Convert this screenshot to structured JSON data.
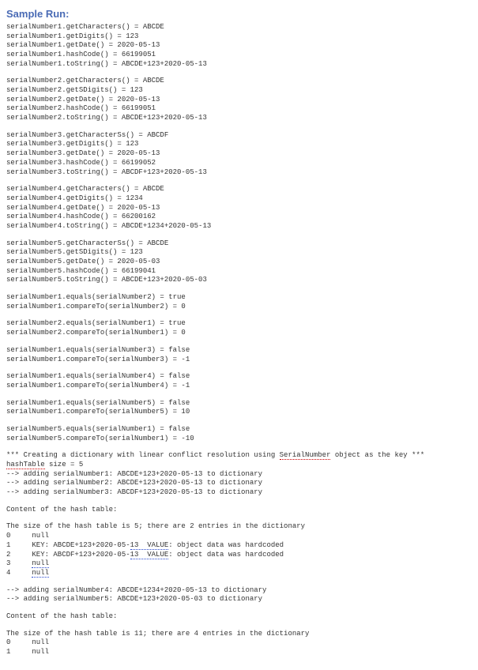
{
  "heading": "Sample Run:",
  "section1": [
    "serialNumber1.getCharacters() = ABCDE",
    "serialNumber1.getDigits() = 123",
    "serialNumber1.getDate() = 2020-05-13",
    "serialNumber1.hashCode() = 66199051",
    "serialNumber1.toString() = ABCDE+123+2020-05-13"
  ],
  "section2": [
    "serialNumber2.getCharacters() = ABCDE",
    "serialNumber2.getSDigits() = 123",
    "serialNumber2.getDate() = 2020-05-13",
    "serialNumber2.hashCode() = 66199051",
    "serialNumber2.toString() = ABCDE+123+2020-05-13"
  ],
  "section3": [
    "serialNumber3.getCharacterSs() = ABCDF",
    "serialNumber3.getDigits() = 123",
    "serialNumber3.getDate() = 2020-05-13",
    "serialNumber3.hashCode() = 66199052",
    "serialNumber3.toString() = ABCDF+123+2020-05-13"
  ],
  "section4": [
    "serialNumber4.getCharacters() = ABCDE",
    "serialNumber4.getDigits() = 1234",
    "serialNumber4.getDate() = 2020-05-13",
    "serialNumber4.hashCode() = 66200162",
    "serialNumber4.toString() = ABCDE+1234+2020-05-13"
  ],
  "section5": [
    "serialNumber5.getCharacterSs() = ABCDE",
    "serialNumber5.getSDigits() = 123",
    "serialNumber5.getDate() = 2020-05-03",
    "serialNumber5.hashCode() = 66199041",
    "serialNumber5.toString() = ABCDE+123+2020-05-03"
  ],
  "cmp1": [
    "serialNumber1.equals(serialNumber2) = true",
    "serialNumber1.compareTo(serialNumber2) = 0"
  ],
  "cmp2": [
    "serialNumber2.equals(serialNumber1) = true",
    "serialNumber2.compareTo(serialNumber1) = 0"
  ],
  "cmp3": [
    "serialNumber1.equals(serialNumber3) = false",
    "serialNumber1.compareTo(serialNumber3) = -1"
  ],
  "cmp4": [
    "serialNumber1.equals(serialNumber4) = false",
    "serialNumber1.compareTo(serialNumber4) = -1"
  ],
  "cmp5": [
    "serialNumber1.equals(serialNumber5) = false",
    "serialNumber1.compareTo(serialNumber5) = 10"
  ],
  "cmp6": [
    "serialNumber5.equals(serialNumber1) = false",
    "serialNumber5.compareTo(serialNumber1) = -10"
  ],
  "dict_header_prefix": "*** Creating a dictionary with linear conflict resolution using ",
  "dict_header_word": "SerialNumber",
  "dict_header_suffix": " object as the key ***",
  "hash_label": "hashTable",
  "hash_size": " size = 5",
  "adds1": [
    "--> adding serialNumber1: ABCDE+123+2020-05-13 to dictionary",
    "--> adding serialNumber2: ABCDE+123+2020-05-13 to dictionary",
    "--> adding serialNumber3: ABCDF+123+2020-05-13 to dictionary"
  ],
  "content_header": "Content of the hash table:",
  "table1_intro": "The size of the hash table is 5; there are 2 entries in the dictionary",
  "t1_row0": "0     null",
  "t1_row1_pre": "1     KEY: ABCDE+123+2020-05-",
  "t1_row1_sq": "13  VALUE",
  "t1_row1_post": ": object data was hardcoded",
  "t1_row2_pre": "2     KEY: ABCDF+123+2020-05-",
  "t1_row2_sq": "13  VALUE",
  "t1_row2_post": ": object data was hardcoded",
  "t1_row3_pre": "3     ",
  "t1_row3_sq": "null",
  "t1_row4_pre": "4     ",
  "t1_row4_sq": "null",
  "adds2": [
    "--> adding serialNumber4: ABCDE+1234+2020-05-13 to dictionary",
    "--> adding serialNumber5: ABCDE+123+2020-05-03 to dictionary"
  ],
  "table2_intro": "The size of the hash table is 11; there are 4 entries in the dictionary",
  "t2_row0": "0     null",
  "t2_row1": "1     null"
}
